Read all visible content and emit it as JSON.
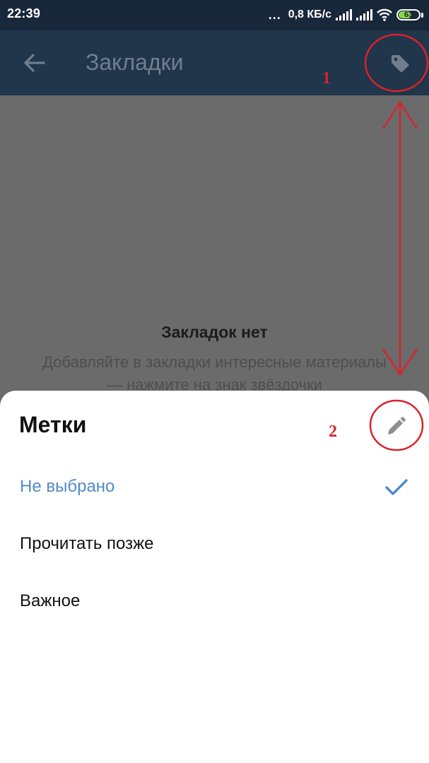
{
  "status_bar": {
    "time": "22:39",
    "dots": "...",
    "speed": "0,8 КБ/с",
    "battery": "63"
  },
  "toolbar": {
    "title": "Закладки",
    "back_icon": "arrow-left-icon",
    "tag_icon": "tag-icon"
  },
  "empty_state": {
    "title": "Закладок нет",
    "description": "Добавляйте в закладки интересные материалы — нажмите на знак звёздочки"
  },
  "sheet": {
    "title": "Метки",
    "edit_icon": "pencil-icon",
    "items": [
      {
        "label": "Не выбрано",
        "selected": true
      },
      {
        "label": "Прочитать позже",
        "selected": false
      },
      {
        "label": "Важное",
        "selected": false
      }
    ]
  },
  "annotations": {
    "marker_1": "1",
    "marker_2": "2",
    "color": "#d8232a"
  },
  "colors": {
    "status_bar": "#19273a",
    "toolbar": "#21354b",
    "accent": "#4f8bc7",
    "scrim": "#6b6b6b"
  }
}
